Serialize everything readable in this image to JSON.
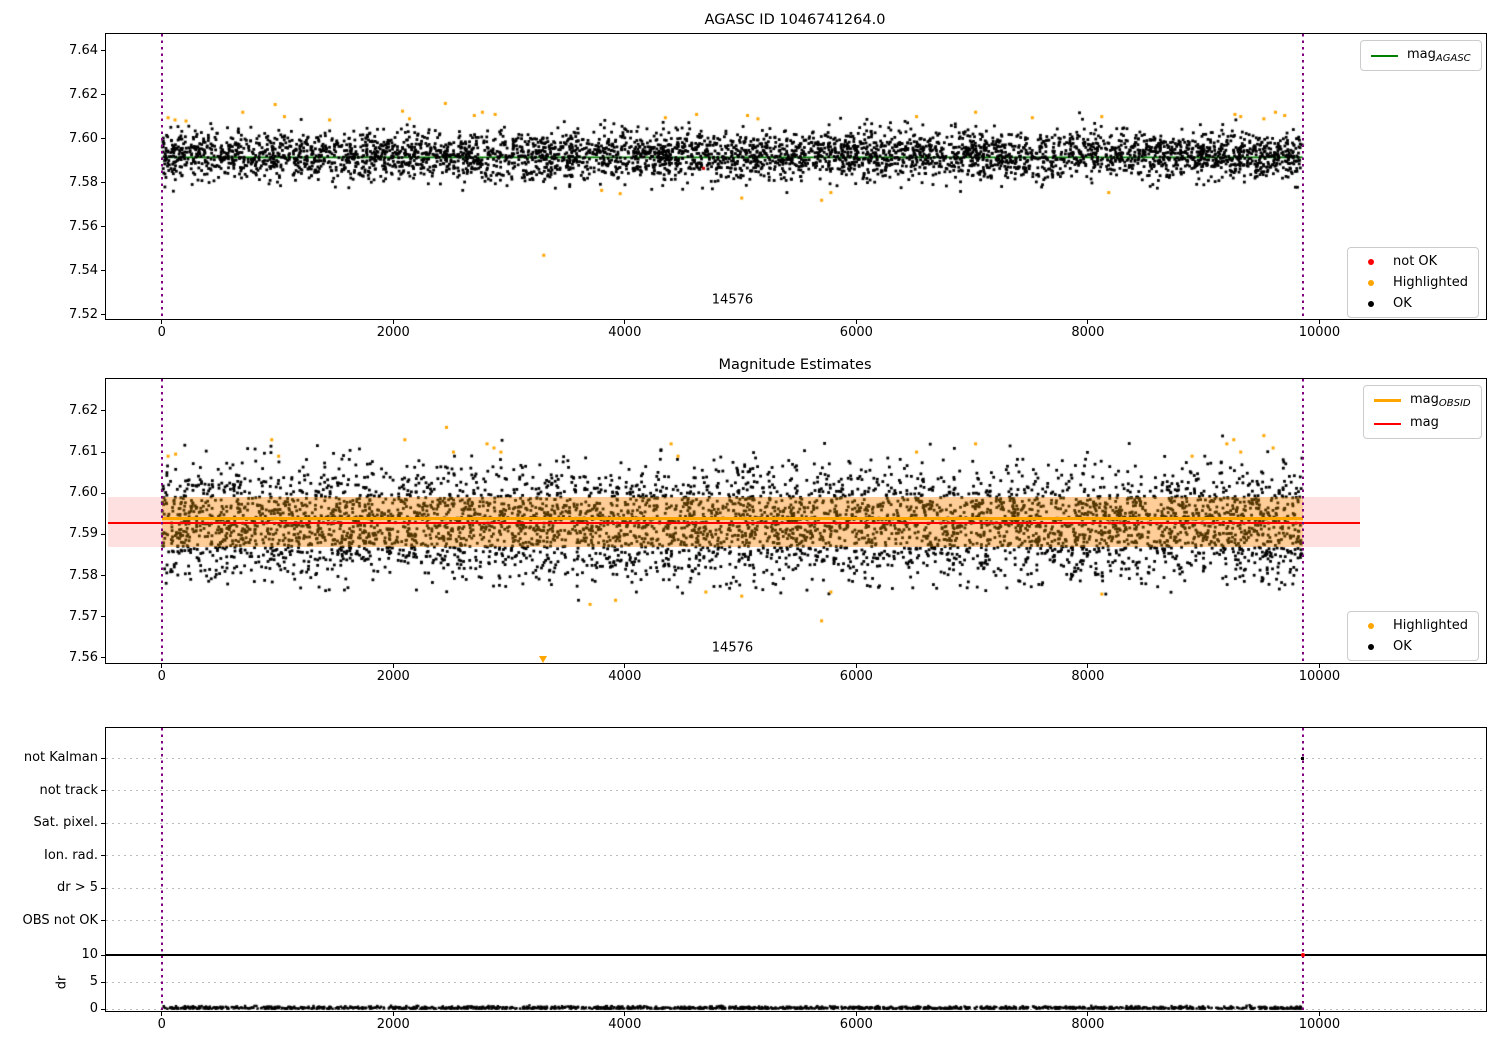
{
  "colors": {
    "ok": "#000000",
    "highlighted": "#ffa500",
    "not_ok": "#ff0000",
    "mag_line": "#ff0000",
    "mag_band": "rgba(255,0,0,0.12)",
    "obsid_line": "#ffa500",
    "obsid_band": "rgba(255,165,0,0.32)",
    "agasc_line": "#008000",
    "vline": "#800080",
    "grid": "#bbbbbb"
  },
  "chart_data": [
    {
      "type": "scatter",
      "title": "AGASC ID 1046741264.0",
      "xlim": [
        -490,
        11430
      ],
      "ylim": [
        7.5185,
        7.648
      ],
      "xticks": [
        0,
        2000,
        4000,
        6000,
        8000,
        10000
      ],
      "xtick_labels": [
        "0",
        "2000",
        "4000",
        "6000",
        "8000",
        "10000"
      ],
      "yticks": [
        7.52,
        7.54,
        7.56,
        7.58,
        7.6,
        7.62,
        7.64
      ],
      "ytick_labels": [
        "7.52",
        "7.54",
        "7.56",
        "7.58",
        "7.60",
        "7.62",
        "7.64"
      ],
      "vlines": [
        0,
        9855
      ],
      "annotation": {
        "text": "14576",
        "x": 4930,
        "y": 7.5265
      },
      "mag_agasc_line": {
        "y": 7.5915,
        "x_start": 0,
        "x_end": 9855,
        "color": "#008000"
      },
      "ok_scatter": {
        "n": 4200,
        "seed": 11,
        "x_min": 5,
        "x_max": 9852,
        "y_mean": 7.5925,
        "y_sigma": 0.0055,
        "y_min": 7.576,
        "y_max": 7.613,
        "color": "#000000"
      },
      "extra_ok_points": [
        [
          2600,
          7.5765
        ],
        [
          3400,
          7.5775
        ],
        [
          4500,
          7.577
        ],
        [
          6900,
          7.576
        ],
        [
          7600,
          7.578
        ],
        [
          1500,
          7.578
        ],
        [
          5400,
          7.5755
        ],
        [
          8600,
          7.5775
        ]
      ],
      "highlighted_points": [
        [
          55,
          7.6095
        ],
        [
          115,
          7.6085
        ],
        [
          210,
          7.608
        ],
        [
          700,
          7.612
        ],
        [
          980,
          7.6155
        ],
        [
          1060,
          7.61
        ],
        [
          1450,
          7.6085
        ],
        [
          2080,
          7.6125
        ],
        [
          2140,
          7.609
        ],
        [
          2450,
          7.616
        ],
        [
          2700,
          7.6105
        ],
        [
          2770,
          7.612
        ],
        [
          2880,
          7.611
        ],
        [
          3300,
          7.547
        ],
        [
          3800,
          7.5765
        ],
        [
          3960,
          7.575
        ],
        [
          4350,
          7.6095
        ],
        [
          4620,
          7.611
        ],
        [
          5010,
          7.573
        ],
        [
          5060,
          7.6105
        ],
        [
          5150,
          7.609
        ],
        [
          5700,
          7.572
        ],
        [
          5780,
          7.5755
        ],
        [
          6520,
          7.61
        ],
        [
          7030,
          7.612
        ],
        [
          7520,
          7.6095
        ],
        [
          8120,
          7.61
        ],
        [
          8180,
          7.5755
        ],
        [
          9270,
          7.611
        ],
        [
          9320,
          7.61
        ],
        [
          9520,
          7.609
        ],
        [
          9620,
          7.612
        ],
        [
          9700,
          7.6105
        ]
      ],
      "not_ok_points": [
        [
          4680,
          7.5865
        ]
      ],
      "legend_line": {
        "items": [
          {
            "label_main": "mag",
            "label_sub": "AGASC",
            "color": "#008000"
          }
        ]
      },
      "legend_markers": {
        "items": [
          {
            "label": "not OK",
            "color": "#ff0000"
          },
          {
            "label": "Highlighted",
            "color": "#ffa500"
          },
          {
            "label": "OK",
            "color": "#000000"
          }
        ]
      }
    },
    {
      "type": "scatter",
      "title": "Magnitude Estimates",
      "xlim": [
        -490,
        11430
      ],
      "ylim": [
        7.559,
        7.628
      ],
      "xticks": [
        0,
        2000,
        4000,
        6000,
        8000,
        10000
      ],
      "xtick_labels": [
        "0",
        "2000",
        "4000",
        "6000",
        "8000",
        "10000"
      ],
      "yticks": [
        7.56,
        7.57,
        7.58,
        7.59,
        7.6,
        7.61,
        7.62
      ],
      "ytick_labels": [
        "7.56",
        "7.57",
        "7.58",
        "7.59",
        "7.60",
        "7.61",
        "7.62"
      ],
      "vlines": [
        0,
        9855
      ],
      "annotation": {
        "text": "14576",
        "x": 4930,
        "y": 7.5625
      },
      "mag_line": {
        "y": 7.593,
        "x_start": -465,
        "x_end": 10350,
        "color": "#ff0000"
      },
      "mag_band": {
        "y_low": 7.587,
        "y_high": 7.599,
        "x_start": -465,
        "x_end": 10350,
        "color": "rgba(255,0,0,0.12)"
      },
      "obsid_line": {
        "y": 7.5938,
        "x_start": 0,
        "x_end": 9855,
        "color": "#ffa500"
      },
      "obsid_band": {
        "y_low": 7.587,
        "y_high": 7.599,
        "x_start": 0,
        "x_end": 9855,
        "color": "rgba(255,165,0,0.32)"
      },
      "ok_scatter": {
        "n": 5000,
        "seed": 23,
        "x_min": 5,
        "x_max": 9852,
        "y_mean": 7.5925,
        "y_sigma": 0.0068,
        "y_min": 7.5755,
        "y_max": 7.615,
        "color": "#000000"
      },
      "extra_ok_points": [
        [
          1200,
          7.577
        ],
        [
          2200,
          7.5765
        ],
        [
          3600,
          7.574
        ],
        [
          6200,
          7.5775
        ],
        [
          7300,
          7.577
        ],
        [
          8500,
          7.578
        ],
        [
          4100,
          7.576
        ]
      ],
      "highlighted_points": [
        [
          55,
          7.609
        ],
        [
          120,
          7.6095
        ],
        [
          950,
          7.613
        ],
        [
          1010,
          7.609
        ],
        [
          2100,
          7.613
        ],
        [
          2460,
          7.616
        ],
        [
          2520,
          7.61
        ],
        [
          2810,
          7.612
        ],
        [
          2870,
          7.611
        ],
        [
          2930,
          7.61
        ],
        [
          3700,
          7.573
        ],
        [
          3920,
          7.574
        ],
        [
          4400,
          7.612
        ],
        [
          4460,
          7.609
        ],
        [
          4700,
          7.576
        ],
        [
          5010,
          7.575
        ],
        [
          5700,
          7.569
        ],
        [
          5780,
          7.576
        ],
        [
          6520,
          7.61
        ],
        [
          7030,
          7.612
        ],
        [
          8120,
          7.5755
        ],
        [
          8900,
          7.609
        ],
        [
          9200,
          7.612
        ],
        [
          9260,
          7.613
        ],
        [
          9320,
          7.61
        ],
        [
          9520,
          7.614
        ],
        [
          9600,
          7.611
        ]
      ],
      "clipped_low_marker": {
        "x": 3290,
        "y": 7.5593,
        "color": "#ffa500"
      },
      "legend_lines": {
        "items": [
          {
            "label_main": "mag",
            "label_sub": "OBSID",
            "color": "#ffa500",
            "thick": true
          },
          {
            "label_main": "mag",
            "label_sub": "",
            "color": "#ff0000",
            "thick": false
          }
        ]
      },
      "legend_markers": {
        "items": [
          {
            "label": "Highlighted",
            "color": "#ffa500"
          },
          {
            "label": "OK",
            "color": "#000000"
          }
        ]
      }
    },
    {
      "type": "flags",
      "flag_labels": [
        "not Kalman",
        "not track",
        "Sat. pixel.",
        "Ion. rad.",
        "dr > 5",
        "OBS not OK"
      ],
      "flag_points": [
        {
          "x": 9855,
          "flag_index": 0,
          "color": "#000000"
        }
      ],
      "dr_axis": {
        "label": "dr",
        "ticks": [
          0,
          5,
          10
        ],
        "tick_labels": [
          "0",
          "5",
          "10"
        ],
        "hline": 10
      },
      "dr_scatter": {
        "n": 1500,
        "seed": 37,
        "x_min": 10,
        "x_max": 9850,
        "y_max": 0.85,
        "color": "#000000"
      },
      "dr_outliers": [
        {
          "x": 9855,
          "y": 10,
          "color": "#ff0000"
        }
      ],
      "xticks": [
        0,
        2000,
        4000,
        6000,
        8000,
        10000
      ],
      "xtick_labels": [
        "0",
        "2000",
        "4000",
        "6000",
        "8000",
        "10000"
      ],
      "vlines": [
        0,
        9855
      ]
    }
  ]
}
